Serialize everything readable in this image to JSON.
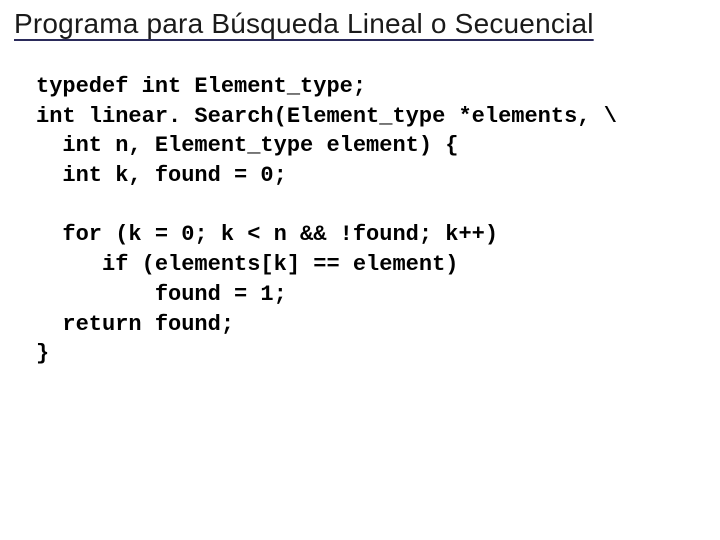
{
  "title": "Programa para Búsqueda Lineal o Secuencial",
  "code": "typedef int Element_type;\nint linear. Search(Element_type *elements, \\\n  int n, Element_type element) {\n  int k, found = 0;\n\n  for (k = 0; k < n && !found; k++)\n     if (elements[k] == element)\n         found = 1;\n  return found;\n}"
}
